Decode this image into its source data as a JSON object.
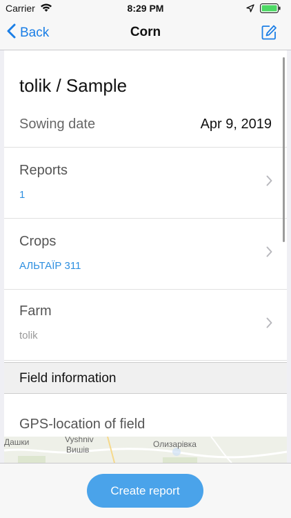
{
  "status_bar": {
    "carrier": "Carrier",
    "time": "8:29 PM"
  },
  "nav": {
    "back_label": "Back",
    "title": "Corn"
  },
  "field": {
    "title": "tolik / Sample",
    "sowing_label": "Sowing date",
    "sowing_value": "Apr 9, 2019"
  },
  "rows": [
    {
      "label": "Reports",
      "value": "1"
    },
    {
      "label": "Crops",
      "value": "АЛЬТАЇР 311"
    },
    {
      "label": "Farm",
      "value": "tolik"
    }
  ],
  "section_header": "Field information",
  "gps": {
    "label": "GPS-location of field",
    "map_labels": [
      "Дашки",
      "Vyshniv",
      "Вишів",
      "Олизарівка"
    ]
  },
  "bottom": {
    "create_report_label": "Create report"
  },
  "colors": {
    "accent": "#1a7ee6",
    "button": "#4aa3ea",
    "link_value": "#2d8fe0"
  }
}
